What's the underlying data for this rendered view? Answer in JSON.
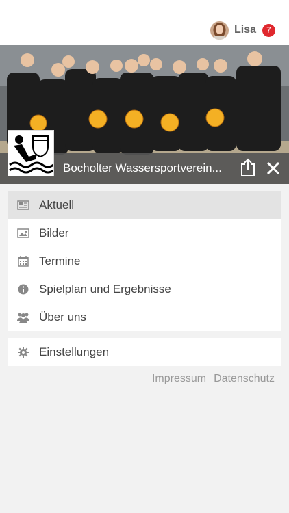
{
  "header": {
    "user_name": "Lisa",
    "notification_count": "7"
  },
  "club": {
    "name": "Bocholter Wassersportverein..."
  },
  "menu": {
    "items": [
      {
        "label": "Aktuell",
        "icon": "newspaper-icon",
        "active": true
      },
      {
        "label": "Bilder",
        "icon": "image-icon",
        "active": false
      },
      {
        "label": "Termine",
        "icon": "calendar-icon",
        "active": false
      },
      {
        "label": "Spielplan und Ergebnisse",
        "icon": "info-icon",
        "active": false
      },
      {
        "label": "Über uns",
        "icon": "group-icon",
        "active": false
      }
    ],
    "settings_label": "Einstellungen"
  },
  "footer": {
    "impressum": "Impressum",
    "datenschutz": "Datenschutz"
  },
  "colors": {
    "badge": "#e0282e",
    "hero_bar": "#555555",
    "active_item": "#e3e3e3"
  }
}
